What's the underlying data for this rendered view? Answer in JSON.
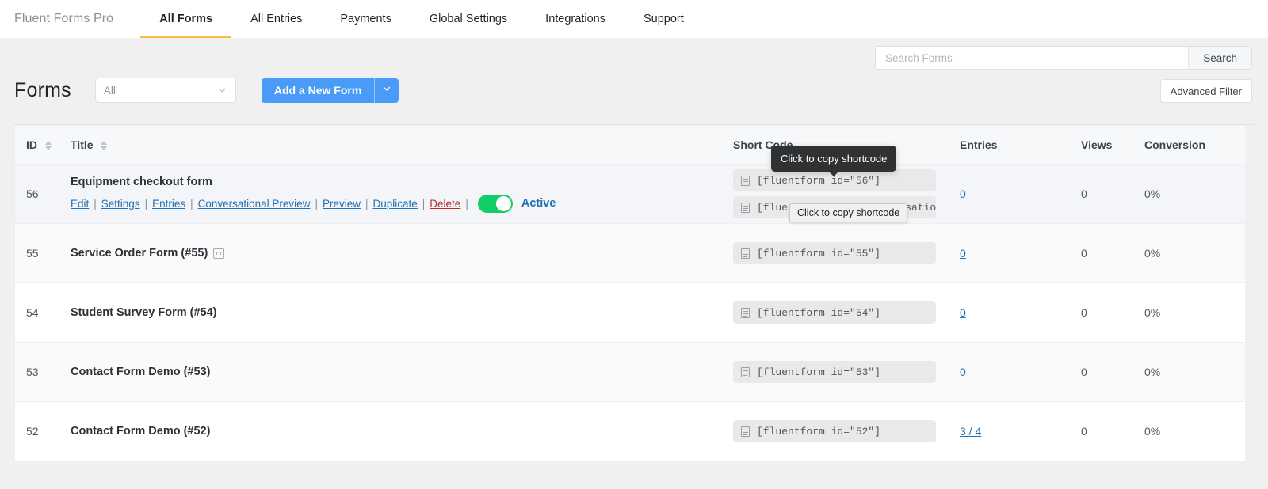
{
  "nav": {
    "brand": "Fluent Forms Pro",
    "items": [
      {
        "label": "All Forms",
        "active": true
      },
      {
        "label": "All Entries",
        "active": false
      },
      {
        "label": "Payments",
        "active": false
      },
      {
        "label": "Global Settings",
        "active": false
      },
      {
        "label": "Integrations",
        "active": false
      },
      {
        "label": "Support",
        "active": false
      }
    ]
  },
  "header": {
    "title": "Forms",
    "filter_value": "All",
    "add_button": "Add a New Form",
    "search_placeholder": "Search Forms",
    "search_value": "",
    "search_button": "Search",
    "advanced_filter": "Advanced Filter"
  },
  "table": {
    "columns": {
      "id": "ID",
      "title": "Title",
      "shortcode": "Short Code",
      "entries": "Entries",
      "views": "Views",
      "conversion": "Conversion"
    },
    "actions": {
      "edit": "Edit",
      "settings": "Settings",
      "entries": "Entries",
      "conversational_preview": "Conversational Preview",
      "preview": "Preview",
      "duplicate": "Duplicate",
      "delete": "Delete",
      "separator": "|"
    },
    "rows": [
      {
        "id": "56",
        "title": "Equipment checkout form",
        "has_conversational_badge": false,
        "shortcodes": [
          "[fluentform id=\"56\"]",
          "[fluentform type=\"conversational\""
        ],
        "entries": "0",
        "entries_link": true,
        "views": "0",
        "conversion": "0%",
        "status_label": "Active",
        "status_on": true,
        "show_actions": true,
        "shade": "shade-hover"
      },
      {
        "id": "55",
        "title": "Service Order Form (#55)",
        "has_conversational_badge": true,
        "shortcodes": [
          "[fluentform id=\"55\"]"
        ],
        "entries": "0",
        "entries_link": true,
        "views": "0",
        "conversion": "0%",
        "status_label": "",
        "status_on": false,
        "show_actions": false,
        "shade": "shade-alt"
      },
      {
        "id": "54",
        "title": "Student Survey Form (#54)",
        "has_conversational_badge": false,
        "shortcodes": [
          "[fluentform id=\"54\"]"
        ],
        "entries": "0",
        "entries_link": true,
        "views": "0",
        "conversion": "0%",
        "status_label": "",
        "status_on": false,
        "show_actions": false,
        "shade": "shade-white"
      },
      {
        "id": "53",
        "title": "Contact Form Demo (#53)",
        "has_conversational_badge": false,
        "shortcodes": [
          "[fluentform id=\"53\"]"
        ],
        "entries": "0",
        "entries_link": true,
        "views": "0",
        "conversion": "0%",
        "status_label": "",
        "status_on": false,
        "show_actions": false,
        "shade": "shade-alt"
      },
      {
        "id": "52",
        "title": "Contact Form Demo (#52)",
        "has_conversational_badge": false,
        "shortcodes": [
          "[fluentform id=\"52\"]"
        ],
        "entries": "3 / 4",
        "entries_link": true,
        "views": "0",
        "conversion": "0%",
        "status_label": "",
        "status_on": false,
        "show_actions": false,
        "shade": "shade-white"
      }
    ]
  },
  "tooltips": {
    "dark": "Click to copy shortcode",
    "native": "Click to copy shortcode"
  },
  "colors": {
    "accent_blue": "#4a9bf7",
    "link_blue": "#2271b1",
    "toggle_green": "#13ce66",
    "tab_underline": "#f5bd42",
    "danger_red": "#b32d2e"
  }
}
